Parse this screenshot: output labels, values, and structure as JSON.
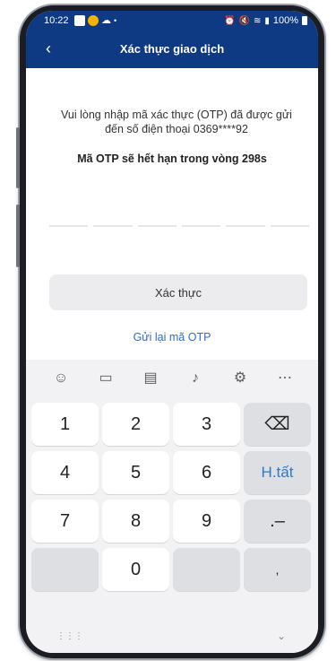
{
  "status_bar": {
    "time": "10:22",
    "right": "100%",
    "left_icons": [
      "image-icon",
      "smile-badge-icon",
      "cloud-icon",
      "dot-icon"
    ],
    "right_icons": [
      "alarm-icon",
      "mute-icon",
      "wifi-icon",
      "lte-icon",
      "signal-icon",
      "battery-icon"
    ]
  },
  "header": {
    "back_icon": "‹",
    "title": "Xác thực giao dịch"
  },
  "otp": {
    "info": "Vui lòng nhập mã xác thực (OTP) đã được gửi đến số điện thoại  0369****92",
    "expiry": "Mã OTP sẽ hết hạn trong vòng  298s",
    "box_count": 6,
    "verify_label": "Xác thực",
    "resend_label": "Gửi lại mã OTP"
  },
  "keyboard": {
    "toolbar_icons": [
      "emoji-icon",
      "clipboard-icon",
      "text-format-icon",
      "microphone-icon",
      "settings-icon",
      "more-icon"
    ],
    "keys": [
      [
        "1",
        "2",
        "3",
        "⌫"
      ],
      [
        "4",
        "5",
        "6",
        "H.tất"
      ],
      [
        "7",
        "8",
        "9",
        ".–"
      ],
      [
        "",
        "0",
        "",
        ","
      ]
    ]
  },
  "colors": {
    "primary": "#0e3a83",
    "link": "#2f6ad9",
    "done_key": "#2e79c8"
  }
}
